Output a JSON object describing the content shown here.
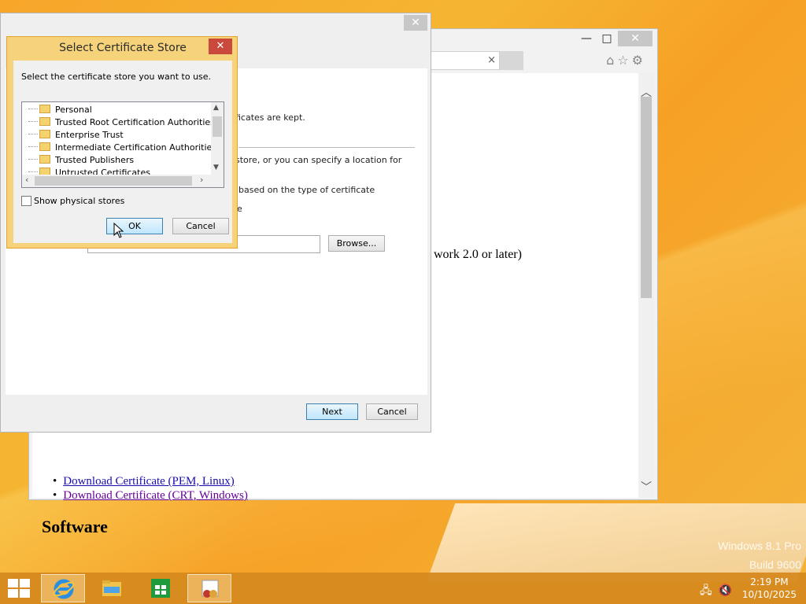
{
  "desktop": {
    "watermark_line1": "Windows 8.1 Pro",
    "watermark_line2": "Build 9600"
  },
  "ie": {
    "tab_close": "×",
    "partial_text": "work 2.0 or later)",
    "links": [
      "Download Certificate (PEM, Linux)",
      "Download Certificate (CRT, Windows)"
    ],
    "heading": "Software",
    "controls": {
      "minimize": "—",
      "maximize": "□",
      "close": "✕"
    }
  },
  "wizard": {
    "close": "✕",
    "text1": "ficates are kept.",
    "text2": "store, or you can specify a location for",
    "text3": "based on the type of certificate",
    "text4": "e",
    "browse_label": "Browse...",
    "next_label": "Next",
    "cancel_label": "Cancel"
  },
  "cert_dialog": {
    "title": "Select Certificate Store",
    "close": "✕",
    "prompt": "Select the certificate store you want to use.",
    "stores": [
      "Personal",
      "Trusted Root Certification Authorities",
      "Enterprise Trust",
      "Intermediate Certification Authorities",
      "Trusted Publishers",
      "Untrusted Certificates"
    ],
    "show_physical_label": "Show physical stores",
    "ok_label": "OK",
    "cancel_label": "Cancel"
  },
  "taskbar": {
    "time": "2:19 PM",
    "date": "10/10/2025"
  }
}
